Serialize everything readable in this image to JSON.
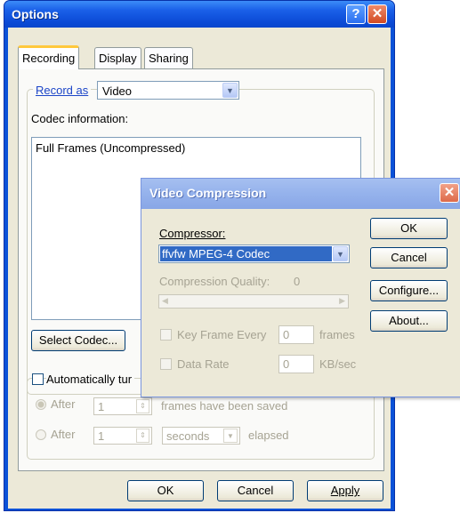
{
  "options": {
    "title": "Options",
    "help_glyph": "?",
    "close_glyph": "✕",
    "tabs": [
      {
        "label": "Recording",
        "active": true
      },
      {
        "label": "Display",
        "active": false
      },
      {
        "label": "Sharing",
        "active": false
      }
    ],
    "record_as": {
      "label": "Record as",
      "value": "Video"
    },
    "codec_information_label": "Codec information:",
    "codec_text": "Full Frames (Uncompressed)",
    "select_codec_label": "Select Codec...",
    "auto_turn_label": "Automatically tur",
    "after_rows": [
      {
        "label": "After",
        "value": "1",
        "unit": "frames have been saved"
      },
      {
        "label": "After",
        "value": "1",
        "unit": "seconds",
        "suffix": "elapsed"
      }
    ],
    "buttons": {
      "ok": "OK",
      "cancel": "Cancel",
      "apply": "Apply"
    }
  },
  "video_compression": {
    "title": "Video Compression",
    "close_glyph": "✕",
    "compressor_label": "Compressor:",
    "compressor_value": "ffvfw MPEG-4 Codec",
    "quality_label": "Compression Quality:",
    "quality_value": "0",
    "key_frame": {
      "label": "Key Frame Every",
      "value": "0",
      "unit": "frames"
    },
    "data_rate": {
      "label": "Data Rate",
      "value": "0",
      "unit": "KB/sec"
    },
    "buttons": {
      "ok": "OK",
      "cancel": "Cancel",
      "configure": "Configure...",
      "about": "About..."
    }
  },
  "icons": {
    "dropdown": "chevron-down",
    "spin": "up-down-arrows",
    "track_left": "left-arrow",
    "track_right": "right-arrow"
  }
}
